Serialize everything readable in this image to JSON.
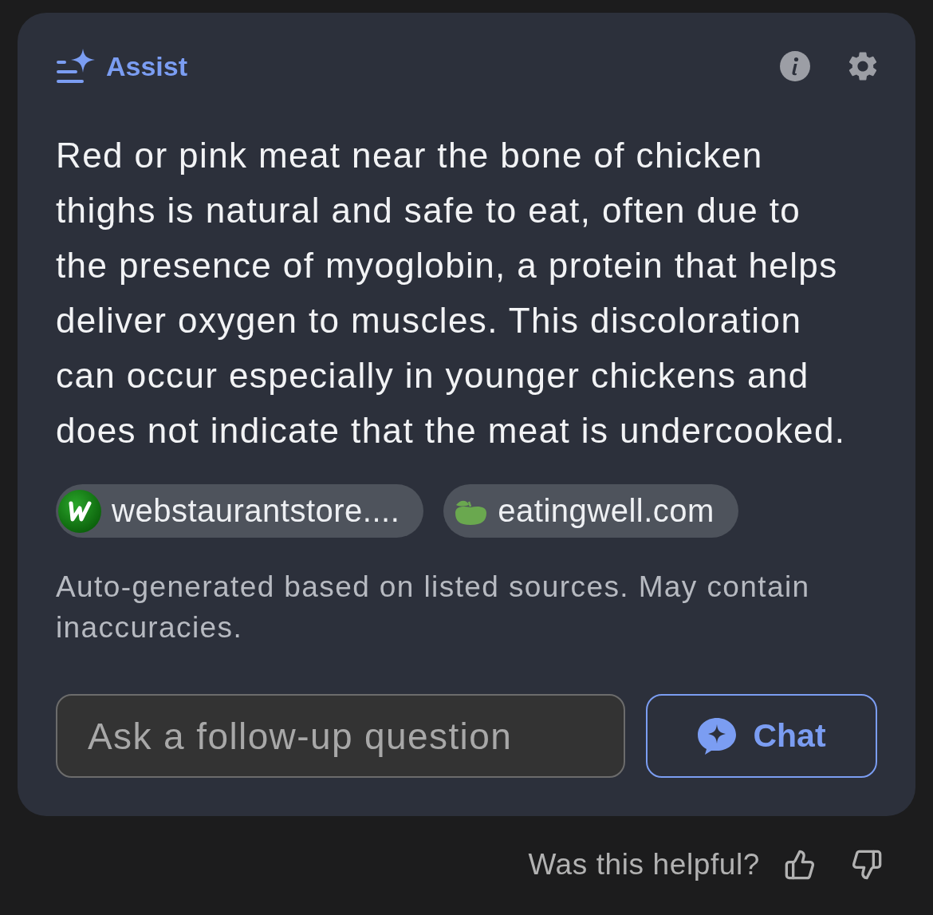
{
  "header": {
    "title": "Assist"
  },
  "answer": {
    "text": "Red or pink meat near the bone of chicken thighs is natural and safe to eat, often due to the presence of myoglobin, a protein that helps deliver oxygen to muscles. This discoloration can occur especially in younger chickens and does not indicate that the meat is undercooked."
  },
  "sources": [
    {
      "label": "webstaurantstore....",
      "kind": "w-logo"
    },
    {
      "label": "eatingwell.com",
      "kind": "apple"
    }
  ],
  "disclaimer": "Auto-generated based on listed sources. May contain inaccuracies.",
  "follow_up": {
    "placeholder": "Ask a follow-up question"
  },
  "chat_button": {
    "label": "Chat"
  },
  "feedback": {
    "prompt": "Was this helpful?"
  }
}
